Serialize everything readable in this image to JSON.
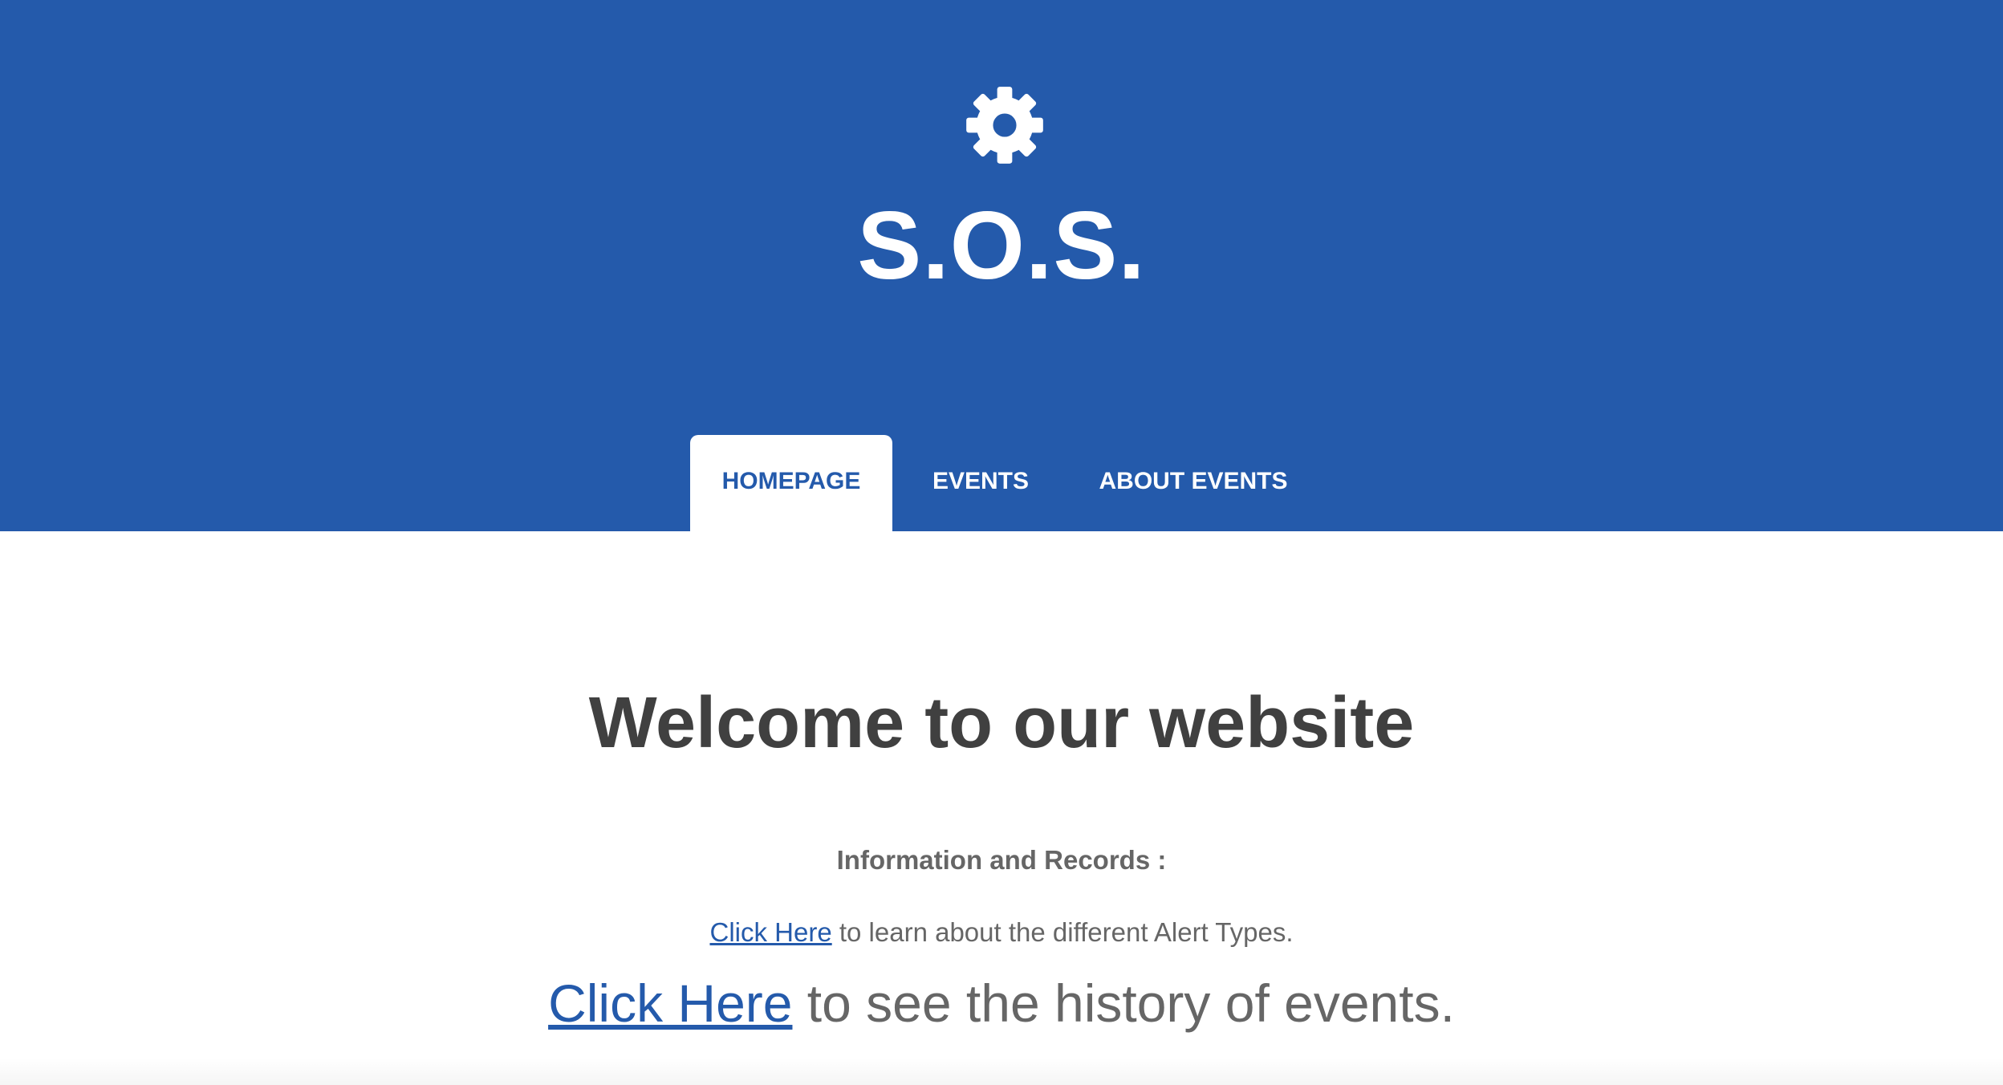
{
  "header": {
    "icon": "gear-icon",
    "title": "S.O.S.",
    "background_color": "#245aab"
  },
  "nav": {
    "tabs": [
      {
        "label": "HOMEPAGE",
        "active": true
      },
      {
        "label": "EVENTS",
        "active": false
      },
      {
        "label": "ABOUT EVENTS",
        "active": false
      }
    ]
  },
  "main": {
    "welcome": "Welcome to our website",
    "info_heading": "Information and Records :",
    "alert_link_text": "Click Here",
    "alert_text": " to learn about the different Alert Types.",
    "history_link_text": "Click Here",
    "history_text": " to see the history of events."
  },
  "colors": {
    "accent": "#245aab",
    "heading_text": "#404040",
    "body_text": "#666666"
  }
}
